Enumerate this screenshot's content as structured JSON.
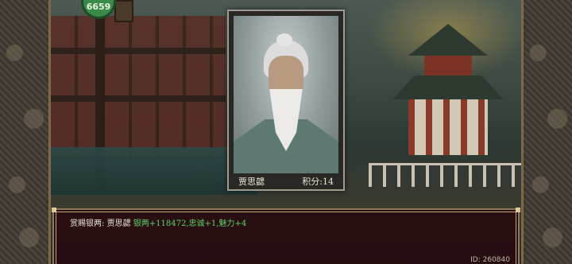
{
  "top_badge": {
    "label": "6659"
  },
  "portrait": {
    "name": "贾思勰",
    "score_label": "积分:",
    "score_value": "14"
  },
  "dialog": {
    "prefix": "赏赐银两:",
    "character": "贾思勰",
    "reward_silver_label": "银两",
    "reward_silver_value": "+118472",
    "reward_loyalty_label": "忠诚",
    "reward_loyalty_value": "+1",
    "reward_charm_label": "魅力",
    "reward_charm_value": "+4",
    "sep1": ",",
    "sep2": ","
  },
  "footer": {
    "id_text": "ID: 260840"
  },
  "colors": {
    "reward_green": "#5cd06a",
    "dialog_bg": "#280c10",
    "frame_gold": "#c0a880"
  }
}
